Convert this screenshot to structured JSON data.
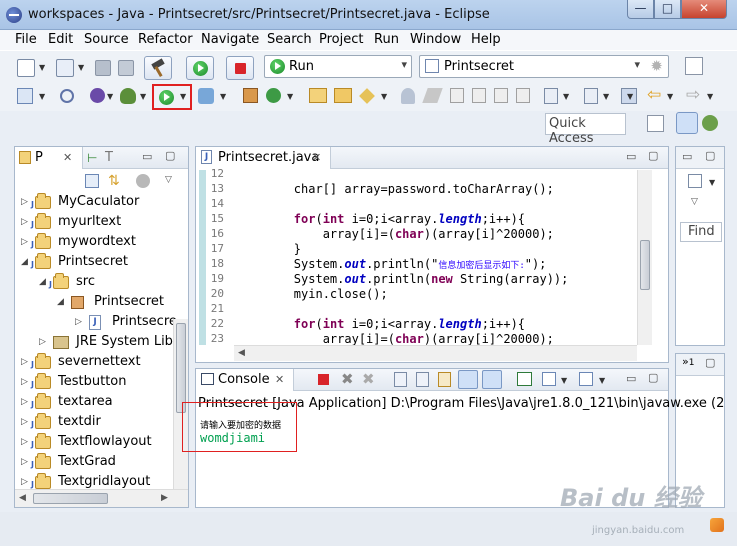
{
  "window": {
    "title": "workspaces - Java - Printsecret/src/Printsecret/Printsecret.java - Eclipse",
    "minimize_glyph": "—",
    "maximize_glyph": "□",
    "close_glyph": "✕"
  },
  "menu": [
    "File",
    "Edit",
    "Source",
    "Refactor",
    "Navigate",
    "Search",
    "Project",
    "Run",
    "Window",
    "Help"
  ],
  "toolbar": {
    "run_combo": "Run",
    "config_combo": "Printsecret",
    "quick_access": "Quick Access"
  },
  "package_explorer": {
    "tab_label": "P",
    "tab2_label": "T",
    "items": [
      {
        "label": "MyCaculator",
        "type": "project",
        "indent": 0
      },
      {
        "label": "myurltext",
        "type": "project",
        "indent": 0
      },
      {
        "label": "mywordtext",
        "type": "project",
        "indent": 0
      },
      {
        "label": "Printsecret",
        "type": "project",
        "indent": 0,
        "expanded": true
      },
      {
        "label": "src",
        "type": "srcfolder",
        "indent": 1,
        "expanded": true
      },
      {
        "label": "Printsecret",
        "type": "package",
        "indent": 2,
        "expanded": true
      },
      {
        "label": "Printsecre",
        "type": "javafile",
        "indent": 3
      },
      {
        "label": "JRE System Libra",
        "type": "library",
        "indent": 1
      },
      {
        "label": "severnettext",
        "type": "project",
        "indent": 0
      },
      {
        "label": "Testbutton",
        "type": "project",
        "indent": 0
      },
      {
        "label": "textarea",
        "type": "project",
        "indent": 0
      },
      {
        "label": "textdir",
        "type": "project",
        "indent": 0
      },
      {
        "label": "Textflowlayout",
        "type": "project",
        "indent": 0
      },
      {
        "label": "TextGrad",
        "type": "project",
        "indent": 0
      },
      {
        "label": "Textgridlayout",
        "type": "project",
        "indent": 0
      }
    ]
  },
  "editor": {
    "tab_label": "Printsecret.java",
    "lines": [
      {
        "n": "12",
        "parts": []
      },
      {
        "n": "13",
        "parts": [
          {
            "t": "        char[] array=password.toCharArray();",
            "c": ""
          }
        ]
      },
      {
        "n": "14",
        "parts": []
      },
      {
        "n": "15",
        "parts": [
          {
            "t": "        ",
            "c": ""
          },
          {
            "t": "for",
            "c": "kw"
          },
          {
            "t": "(",
            "c": ""
          },
          {
            "t": "int",
            "c": "kw"
          },
          {
            "t": " i=0;i<array.",
            "c": ""
          },
          {
            "t": "length",
            "c": "fld"
          },
          {
            "t": ";i++){",
            "c": ""
          }
        ]
      },
      {
        "n": "16",
        "parts": [
          {
            "t": "            array[i]=(",
            "c": ""
          },
          {
            "t": "char",
            "c": "kw"
          },
          {
            "t": ")(array[i]^20000);",
            "c": ""
          }
        ]
      },
      {
        "n": "17",
        "parts": [
          {
            "t": "        }",
            "c": ""
          }
        ]
      },
      {
        "n": "18",
        "parts": [
          {
            "t": "        System.",
            "c": ""
          },
          {
            "t": "out",
            "c": "fld"
          },
          {
            "t": ".println(\"",
            "c": ""
          },
          {
            "t": "信息加密后显示如下:",
            "c": "str str-small"
          },
          {
            "t": "\");",
            "c": ""
          }
        ]
      },
      {
        "n": "19",
        "parts": [
          {
            "t": "        System.",
            "c": ""
          },
          {
            "t": "out",
            "c": "fld"
          },
          {
            "t": ".println(",
            "c": ""
          },
          {
            "t": "new",
            "c": "kw"
          },
          {
            "t": " String(array));",
            "c": ""
          }
        ]
      },
      {
        "n": "20",
        "parts": [
          {
            "t": "        myin.close();",
            "c": ""
          }
        ]
      },
      {
        "n": "21",
        "parts": []
      },
      {
        "n": "22",
        "parts": [
          {
            "t": "        ",
            "c": ""
          },
          {
            "t": "for",
            "c": "kw"
          },
          {
            "t": "(",
            "c": ""
          },
          {
            "t": "int",
            "c": "kw"
          },
          {
            "t": " i=0;i<array.",
            "c": ""
          },
          {
            "t": "length",
            "c": "fld"
          },
          {
            "t": ";i++){",
            "c": ""
          }
        ]
      },
      {
        "n": "23",
        "parts": [
          {
            "t": "            array[i]=(",
            "c": ""
          },
          {
            "t": "char",
            "c": "kw"
          },
          {
            "t": ")(array[i]^20000);",
            "c": ""
          }
        ]
      }
    ]
  },
  "right_panel": {
    "find_label": "Find",
    "tab_badge": "1"
  },
  "console": {
    "tab_label": "Console",
    "header": "Printsecret [Java Application] D:\\Program Files\\Java\\jre1.8.0_121\\bin\\javaw.exe (2",
    "prompt": "请输入要加密的数据",
    "input": "womdjiami"
  },
  "watermark": {
    "main": "Bai du 经验",
    "sub": "jingyan.baidu.com"
  },
  "colors": {
    "keyword": "#7f0055",
    "field": "#0000c0",
    "string": "#2a00ff",
    "console_input": "#00a050",
    "highlight": "#e02020"
  }
}
